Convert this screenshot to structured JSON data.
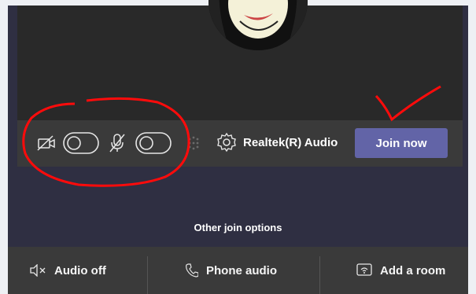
{
  "control_bar": {
    "device_label": "Realtek(R) Audio",
    "join_label": "Join now"
  },
  "other_join_options": "Other join options",
  "bottom_options": [
    {
      "label": "Audio off",
      "icon": "speaker-off-icon"
    },
    {
      "label": "Phone audio",
      "icon": "phone-icon"
    },
    {
      "label": "Add a room",
      "icon": "room-cast-icon"
    }
  ]
}
